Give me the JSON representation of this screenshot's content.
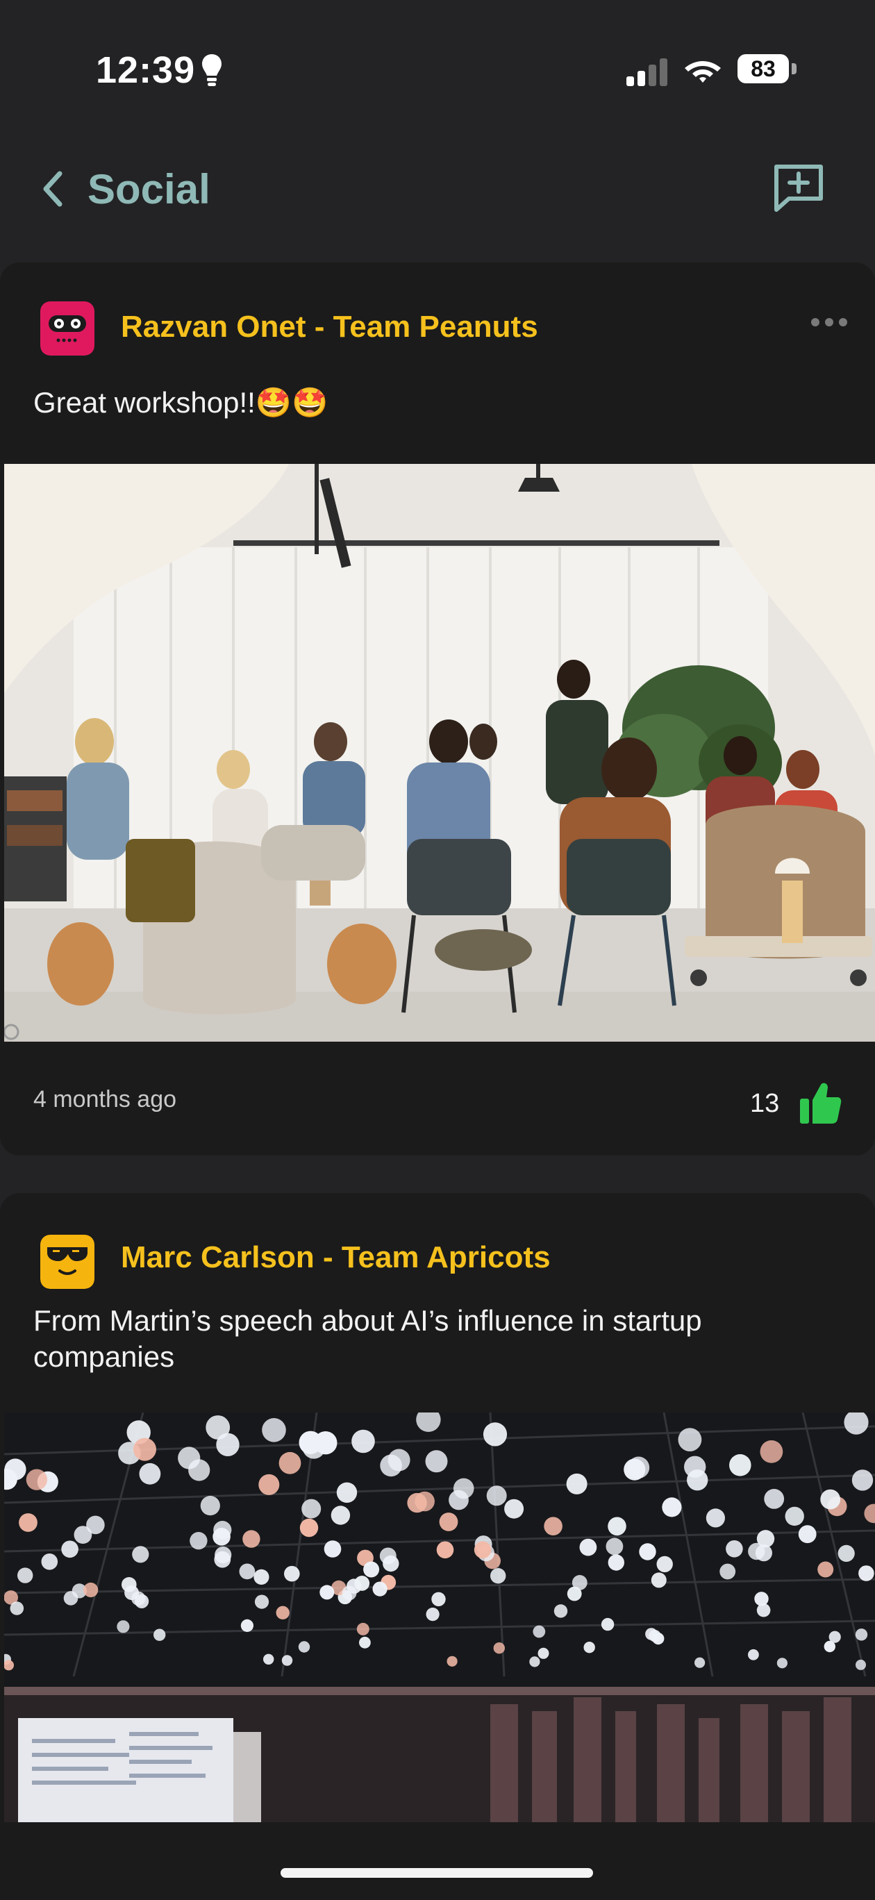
{
  "status_bar": {
    "time": "12:39",
    "battery_level": "83",
    "icons": [
      "lightbulb-icon",
      "cellular-signal-icon",
      "wifi-icon",
      "battery-icon"
    ]
  },
  "header": {
    "title": "Social",
    "back_icon": "chevron-left-icon",
    "new_post_icon": "chat-plus-icon",
    "accent": "#8fb9b6"
  },
  "posts": [
    {
      "author": "Razvan Onet - Team Peanuts",
      "avatar_icon": "robot-face-avatar",
      "avatar_color": "#e0195f",
      "text": "Great workshop!!🤩🤩",
      "image": "workshop-group-photo",
      "timestamp": "4 months ago",
      "likes": "13",
      "like_color": "#30c74f"
    },
    {
      "author": "Marc Carlson - Team Apricots",
      "avatar_icon": "sunglasses-face-avatar",
      "avatar_color": "#f6b40e",
      "text": "From Martin’s speech about AI’s influence in startup companies",
      "image": "conference-hall-lights-photo"
    }
  ],
  "colors": {
    "background": "#232325",
    "card": "#1b1b1b",
    "author_name": "#f6c11d"
  }
}
